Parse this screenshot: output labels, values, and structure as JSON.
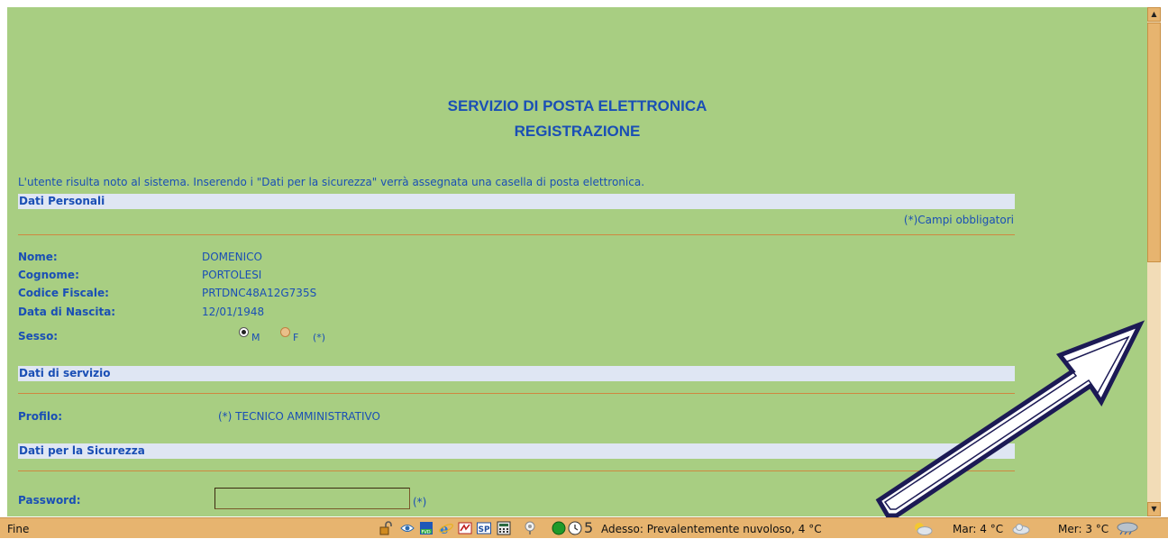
{
  "page": {
    "title_line1": "SERVIZIO DI POSTA ELETTRONICA",
    "title_line2": "REGISTRAZIONE",
    "intro": "L'utente risulta noto al sistema. Inserendo i \"Dati per la sicurezza\" verrà assegnata una casella di posta elettronica.",
    "required_note": "(*)Campi obbligatori"
  },
  "sections": {
    "personal": "Dati Personali",
    "service": "Dati di servizio",
    "security": "Dati per la Sicurezza"
  },
  "personal": {
    "nome_label": "Nome:",
    "nome_value": "DOMENICO",
    "cognome_label": "Cognome:",
    "cognome_value": "PORTOLESI",
    "cf_label": "Codice Fiscale:",
    "cf_value": "PRTDNC48A12G735S",
    "dob_label": "Data di Nascita:",
    "dob_value": "12/01/1948",
    "sesso_label": "Sesso:",
    "sesso_m": "M",
    "sesso_f": "F",
    "sesso_req": "(*)",
    "sesso_selected": "M"
  },
  "service": {
    "profilo_label": "Profilo:",
    "profilo_value": "(*) TECNICO AMMINISTRATIVO"
  },
  "security": {
    "password_label": "Password:",
    "password_value": "",
    "password_req": "(*)"
  },
  "statusbar": {
    "status": "Fine",
    "tray_count": "5",
    "weather_now": "Adesso: Prevalentemente nuvoloso, 4 °C",
    "weather_tue": "Mar: 4 °C",
    "weather_wed": "Mer: 3 °C"
  },
  "icons": [
    "lock-icon",
    "eye-icon",
    "fvd-icon",
    "ie-icon",
    "reader-icon",
    "sp-icon",
    "calculator-icon",
    "pin-icon",
    "green-dot-icon",
    "clock-icon",
    "partly-cloudy-icon",
    "cloud-icon",
    "rain-cloud-icon"
  ],
  "colors": {
    "page_bg": "#a8ce82",
    "text_blue": "#1a4fb5",
    "section_bg": "#dfe6f3",
    "rule": "#cf8740",
    "chrome": "#e7b46f",
    "annotation_arrow": "#1c1a55"
  }
}
